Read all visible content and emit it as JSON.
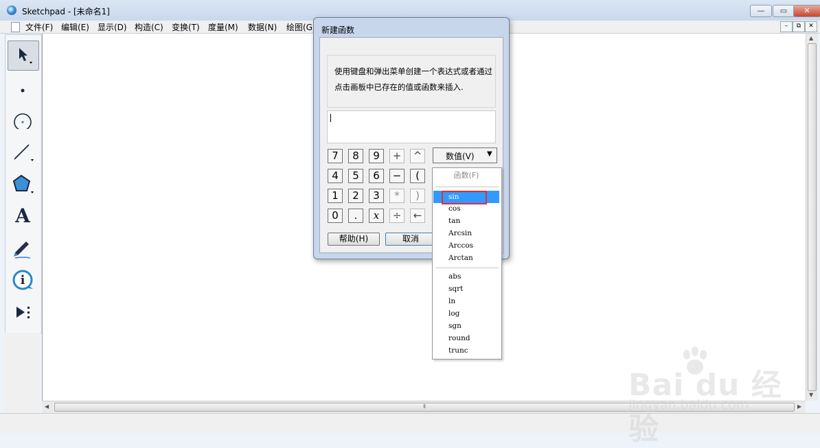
{
  "window": {
    "title": "Sketchpad  - [未命名1]",
    "controls": {
      "minimize": "—",
      "maximize": "▭",
      "close": "✕"
    }
  },
  "menubar": {
    "items": [
      "文件(F)",
      "编辑(E)",
      "显示(D)",
      "构造(C)",
      "变换(T)",
      "度量(M)",
      "数据(N)",
      "绘图(G"
    ],
    "doc_controls": {
      "minimize": "–",
      "restore": "⧉",
      "close": "✕"
    }
  },
  "toolbox": {
    "tools": [
      "arrow-select-icon",
      "point-icon",
      "compass-icon",
      "straightedge-icon",
      "polygon-icon",
      "text-tool-icon",
      "marker-icon",
      "information-icon",
      "custom-tool-icon"
    ],
    "text_tool_glyph": "A",
    "info_glyph": "i"
  },
  "scrollbar": {
    "grip": "⦀"
  },
  "dialog": {
    "title": "新建函数",
    "description": "使用键盘和弹出菜单创建一个表达式或者通过点击画板中已存在的值或函数来插入.",
    "expression": "",
    "keypad": {
      "row1": [
        "7",
        "8",
        "9",
        "+",
        "^"
      ],
      "row2": [
        "4",
        "5",
        "6",
        "−",
        "("
      ],
      "row3": [
        "1",
        "2",
        "3",
        "*",
        ")"
      ],
      "row4": [
        "0",
        ".",
        "𝑥",
        "÷",
        "←"
      ]
    },
    "values_button": "数值(V)",
    "help_button": "帮助(H)",
    "cancel_button": "取消"
  },
  "function_menu": {
    "header": "函数(F)",
    "selected": "sin",
    "group1": [
      "sin",
      "cos",
      "tan",
      "Arcsin",
      "Arccos",
      "Arctan"
    ],
    "group2": [
      "abs",
      "sqrt",
      "ln",
      "log",
      "sgn",
      "round",
      "trunc"
    ]
  },
  "watermark": {
    "logo": "Bai du 经验",
    "url": "jingyan.baidu.com"
  },
  "colors": {
    "highlight": "#3399ff",
    "annotation_box": "#e03030",
    "title_bar": "#c9d8ec"
  }
}
